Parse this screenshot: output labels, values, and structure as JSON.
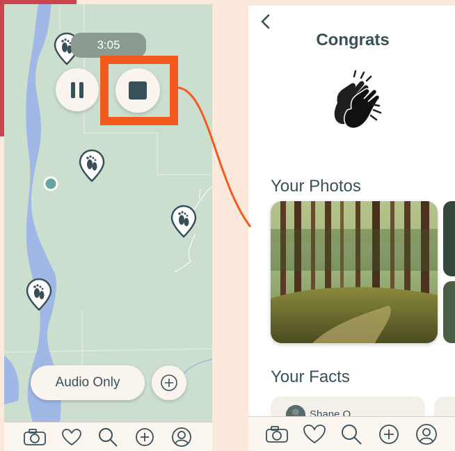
{
  "left_screen": {
    "timer": "3:05",
    "audio_button_label": "Audio Only",
    "controls": {
      "pause": "pause-icon",
      "stop": "stop-icon",
      "add": "plus-circle-icon"
    },
    "map_markers": [
      "footprint-pin-icon",
      "footprint-pin-icon",
      "footprint-pin-icon",
      "footprint-pin-icon"
    ],
    "nav_icons": [
      "camera-icon",
      "heart-icon",
      "search-icon",
      "plus-circle-icon",
      "profile-icon"
    ]
  },
  "right_screen": {
    "title": "Congrats",
    "back_icon": "chevron-left-icon",
    "celebration_icon": "clapping-hands-icon",
    "photos_heading": "Your Photos",
    "facts_heading": "Your Facts",
    "fact_author": "Shane O",
    "nav_icons": [
      "camera-icon",
      "heart-icon",
      "search-icon",
      "plus-circle-icon",
      "profile-icon"
    ]
  },
  "colors": {
    "accent_highlight": "#f25a1e",
    "primary_text": "#37505a",
    "map_land": "#ccdfcf",
    "map_water": "#9fb8e6",
    "background": "#fde8dc"
  }
}
